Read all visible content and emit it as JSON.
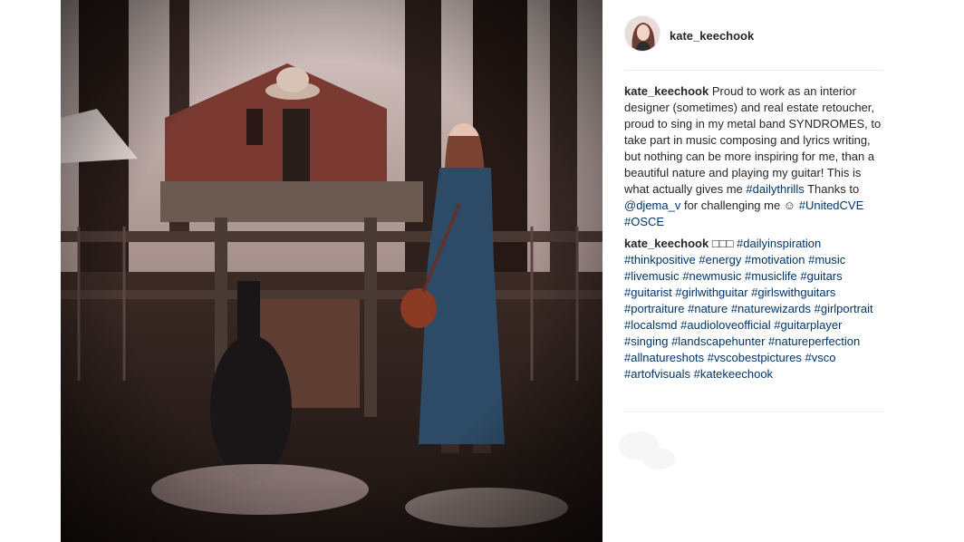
{
  "post": {
    "username": "kate_keechook",
    "caption": {
      "username": "kate_keechook",
      "text": "Proud to work as an interior designer (sometimes) and real estate retoucher, proud to sing in my metal band SYNDROMES, to take part in music composing and lyrics writing, but nothing can be more inspiring for me, than a beautiful nature and playing my guitar! This is what actually gives me",
      "tag1": "#dailythrills",
      "thanks_prefix": "Thanks to",
      "mention": "@djema_v",
      "thanks_suffix": "for challenging me ☺",
      "tag2": "#UnitedCVE",
      "tag3": "#OSCE"
    },
    "comment": {
      "username": "kate_keechook",
      "emoji_text": "□□□",
      "tags": [
        "#dailyinspiration",
        "#thinkpositive",
        "#energy",
        "#motivation",
        "#music",
        "#livemusic",
        "#newmusic",
        "#musiclife",
        "#guitars",
        "#guitarist",
        "#girlwithguitar",
        "#girlswithguitars",
        "#portraiture",
        "#nature",
        "#naturewizards",
        "#girlportrait",
        "#localsmd",
        "#audioloveofficial",
        "#guitarplayer",
        "#singing",
        "#landscapehunter",
        "#natureperfection",
        "#allnatureshots",
        "#vscobestpictures",
        "#vsco",
        "#artofvisuals",
        "#katekeechook"
      ]
    }
  },
  "colors": {
    "text": "#262626",
    "link": "#003569",
    "divider": "#efefef"
  }
}
